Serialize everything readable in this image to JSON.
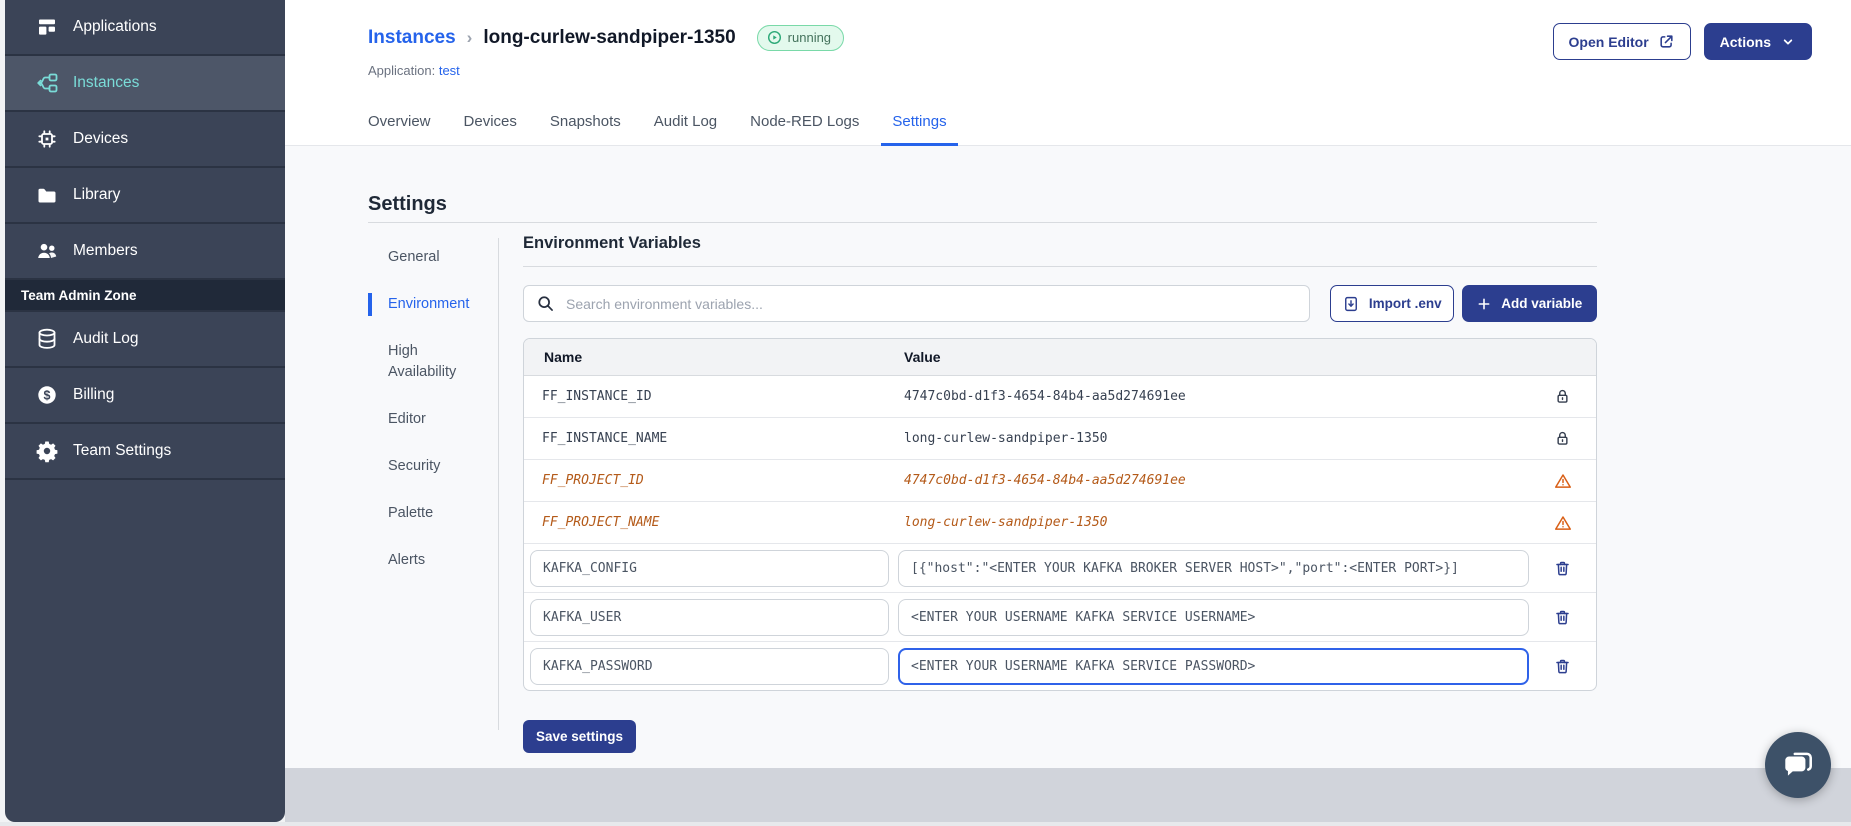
{
  "colors": {
    "sidebar_bg": "#3b4457",
    "sidebar_selected_bg": "#4d5668",
    "sidebar_teal_accent": "#7adcd8",
    "team_admin_zone_bg": "#202939",
    "link_blue": "#2563eb",
    "navy_button": "#2c3e8f",
    "running_badge_bg": "#e3f9ed",
    "running_badge_border": "#79d9a8",
    "running_badge_text": "#45735d",
    "deprecated_orange": "#b45a19",
    "warning_icon_orange": "#d95f16",
    "content_bg": "#f8f9fb",
    "footer_strip": "#d1d4db"
  },
  "sidebar": {
    "items": [
      {
        "label": "Applications",
        "icon": "applications-icon",
        "active": false
      },
      {
        "label": "Instances",
        "icon": "instances-icon",
        "active": true
      },
      {
        "label": "Devices",
        "icon": "devices-icon",
        "active": false
      },
      {
        "label": "Library",
        "icon": "library-icon",
        "active": false
      },
      {
        "label": "Members",
        "icon": "members-icon",
        "active": false
      }
    ],
    "section_label": "Team Admin Zone",
    "admin_items": [
      {
        "label": "Audit Log",
        "icon": "audit-log-icon"
      },
      {
        "label": "Billing",
        "icon": "billing-icon"
      },
      {
        "label": "Team Settings",
        "icon": "team-settings-icon"
      }
    ]
  },
  "header": {
    "breadcrumb": {
      "root": "Instances",
      "separator": "›",
      "current": "long-curlew-sandpiper-1350"
    },
    "status_badge": {
      "label": "running"
    },
    "application": {
      "label": "Application:",
      "name": "test"
    },
    "buttons": {
      "open_editor": "Open Editor",
      "actions": "Actions"
    },
    "tabs": [
      {
        "label": "Overview",
        "active": false
      },
      {
        "label": "Devices",
        "active": false
      },
      {
        "label": "Snapshots",
        "active": false
      },
      {
        "label": "Audit Log",
        "active": false
      },
      {
        "label": "Node-RED Logs",
        "active": false
      },
      {
        "label": "Settings",
        "active": true
      }
    ]
  },
  "settings": {
    "title": "Settings",
    "nav": [
      {
        "label": "General",
        "active": false
      },
      {
        "label": "Environment",
        "active": true
      },
      {
        "label": "High Availability",
        "active": false
      },
      {
        "label": "Editor",
        "active": false
      },
      {
        "label": "Security",
        "active": false
      },
      {
        "label": "Palette",
        "active": false
      },
      {
        "label": "Alerts",
        "active": false
      }
    ],
    "env": {
      "title": "Environment Variables",
      "search_placeholder": "Search environment variables...",
      "import_button": "Import .env",
      "add_button": "Add variable",
      "columns": [
        "Name",
        "Value"
      ],
      "rows": [
        {
          "name": "FF_INSTANCE_ID",
          "value": "4747c0bd-d1f3-4654-84b4-aa5d274691ee",
          "type": "locked"
        },
        {
          "name": "FF_INSTANCE_NAME",
          "value": "long-curlew-sandpiper-1350",
          "type": "locked"
        },
        {
          "name": "FF_PROJECT_ID",
          "value": "4747c0bd-d1f3-4654-84b4-aa5d274691ee",
          "type": "deprecated"
        },
        {
          "name": "FF_PROJECT_NAME",
          "value": "long-curlew-sandpiper-1350",
          "type": "deprecated"
        },
        {
          "name": "KAFKA_CONFIG",
          "value": "[{\"host\":\"<ENTER YOUR KAFKA BROKER SERVER HOST>\",\"port\":<ENTER PORT>}]",
          "type": "editable",
          "focused": false
        },
        {
          "name": "KAFKA_USER",
          "value": "<ENTER YOUR USERNAME KAFKA SERVICE USERNAME>",
          "type": "editable",
          "focused": false
        },
        {
          "name": "KAFKA_PASSWORD",
          "value": "<ENTER YOUR USERNAME KAFKA SERVICE PASSWORD>",
          "type": "editable",
          "focused": true
        }
      ],
      "save_button": "Save settings"
    }
  }
}
